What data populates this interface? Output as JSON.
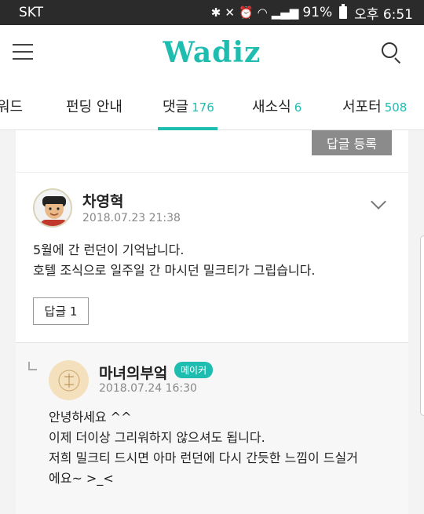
{
  "status_bar": {
    "carrier": "SKT",
    "icons": [
      "bluetooth-icon",
      "mute-icon",
      "alarm-icon",
      "wifi-icon",
      "signal-icon"
    ],
    "battery": "91%",
    "time": "오후 6:51"
  },
  "header": {
    "logo": "Wadiz",
    "menu_icon": "hamburger-icon",
    "search_icon": "search-icon",
    "brand_color": "#1fbdb0"
  },
  "tabs": [
    {
      "label": "워드",
      "count": ""
    },
    {
      "label": "펀딩 안내",
      "count": ""
    },
    {
      "label": "댓글",
      "count": "176",
      "active": true
    },
    {
      "label": "새소식",
      "count": "6"
    },
    {
      "label": "서포터",
      "count": "508"
    }
  ],
  "comment_form": {
    "submit_label": "답글 등록"
  },
  "comment": {
    "author": "차영혁",
    "date": "2018.07.23 21:38",
    "lines": [
      "5월에 간 런던이 기억납니다.",
      "호텔 조식으로 일주일 간 마시던 밀크티가 그립습니다."
    ],
    "reply_button": "답글 1",
    "expand_icon": "chevron-down-icon"
  },
  "reply": {
    "author": "마녀의부엌",
    "badge": "메이커",
    "date": "2018.07.24 16:30",
    "lines": [
      "안녕하세요 ^^",
      "이제 더이상 그리워하지 않으셔도 됩니다.",
      "저희 밀크티 드시면 아마 런던에 다시 간듯한 느낌이 드실거",
      "에요~ >_<"
    ]
  }
}
